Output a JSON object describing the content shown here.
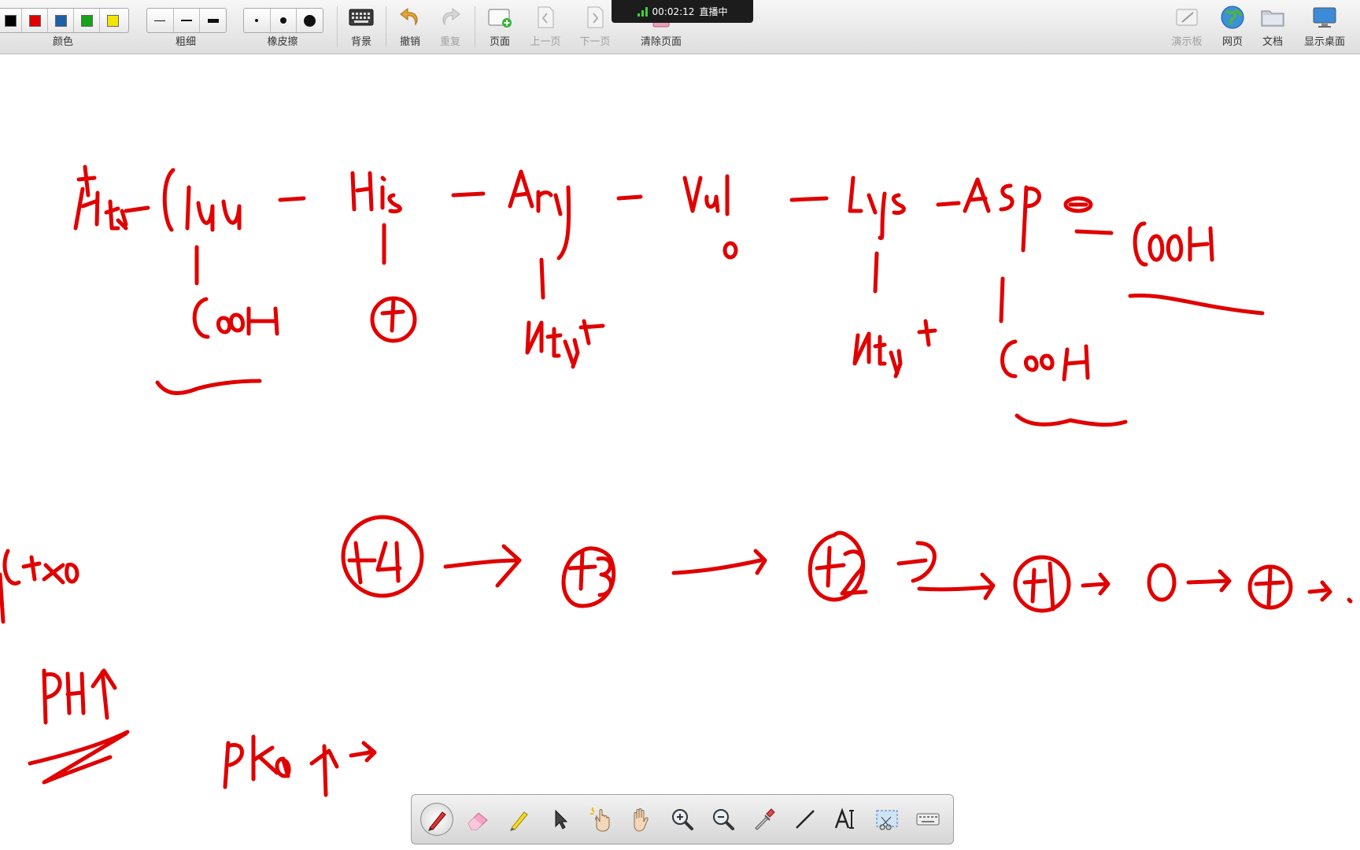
{
  "toolbar": {
    "color": {
      "label": "颜色",
      "swatches": [
        "#000000",
        "#e00000",
        "#1f5fa8",
        "#17a317",
        "#f5e400"
      ]
    },
    "thickness": {
      "label": "粗细"
    },
    "eraser": {
      "label": "橡皮擦"
    },
    "buttons": {
      "background": "背景",
      "undo": "撤销",
      "redo": "重复",
      "page": "页面",
      "prev_page": "上一页",
      "next_page": "下一页",
      "clear_page": "清除页面",
      "whiteboard": "演示板",
      "webpage": "网页",
      "document": "文档",
      "desktop": "显示桌面"
    }
  },
  "live": {
    "time": "00:02:12",
    "status": "直播中"
  },
  "ink_color": "#e00000",
  "bottom_tools": [
    "pen",
    "eraser",
    "highlighter",
    "pointer",
    "laser-pointer",
    "hand",
    "zoom-in",
    "zoom-out",
    "dropper",
    "line",
    "text",
    "screenshot",
    "keyboard"
  ]
}
